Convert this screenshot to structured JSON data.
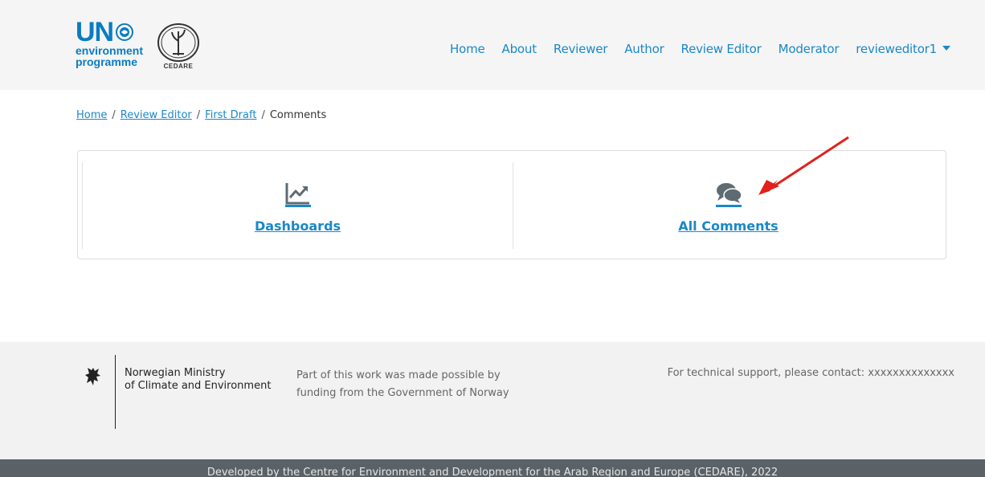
{
  "header": {
    "unep_logo": {
      "un": "UN",
      "line1": "environment",
      "line2": "programme"
    },
    "cedare_logo": {
      "text": "CEDARE"
    },
    "nav": [
      {
        "label": "Home"
      },
      {
        "label": "About"
      },
      {
        "label": "Reviewer"
      },
      {
        "label": "Author"
      },
      {
        "label": "Review Editor"
      },
      {
        "label": "Moderator"
      }
    ],
    "user_menu": {
      "label": "revieweditor1"
    }
  },
  "breadcrumb": {
    "items": [
      "Home",
      "Review Editor",
      "First Draft"
    ],
    "current": "Comments",
    "separator": "/"
  },
  "tiles": [
    {
      "label": "Dashboards",
      "icon": "chart-line-icon"
    },
    {
      "label": "All Comments",
      "icon": "comments-icon"
    }
  ],
  "footer": {
    "ministry_line1": "Norwegian Ministry",
    "ministry_line2": "of Climate and Environment",
    "funding_line1": "Part of this work was made possible by",
    "funding_line2": "funding from the Government of Norway",
    "support": "For technical support, please contact: xxxxxxxxxxxxxx",
    "developed_by": "Developed by the Centre for Environment and Development for the Arab Region and Europe (CEDARE), 2022"
  },
  "colors": {
    "link": "#1a88c9",
    "unep_blue": "#0a7cc1",
    "icon_gray": "#5f6b73",
    "arrow_red": "#e3201b",
    "footer_bg": "#f2f2f2",
    "bottom_bar_bg": "#5a6268"
  }
}
